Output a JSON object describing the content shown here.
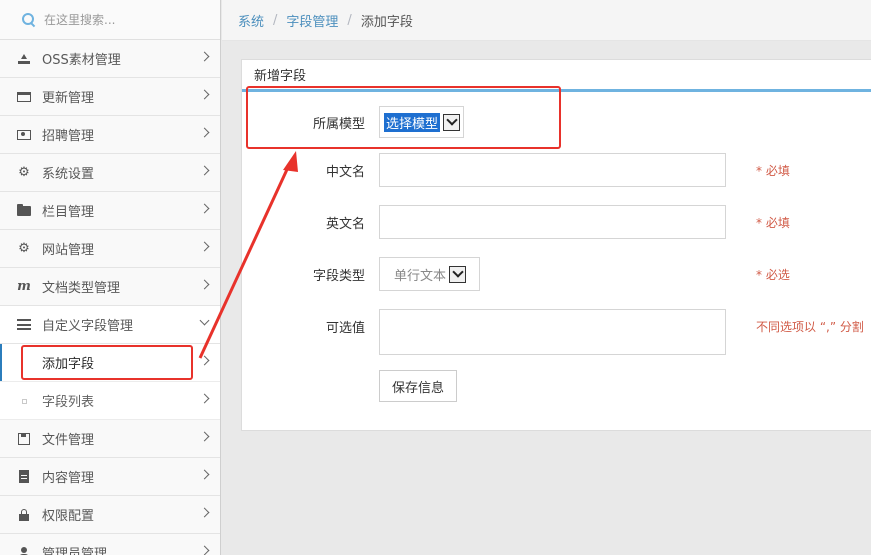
{
  "search": {
    "placeholder": "在这里搜索..."
  },
  "sidebar": {
    "items": [
      {
        "label": "OSS素材管理",
        "icon": "upload-icon"
      },
      {
        "label": "更新管理",
        "icon": "credit-card-icon"
      },
      {
        "label": "招聘管理",
        "icon": "money-icon"
      },
      {
        "label": "系统设置",
        "icon": "cog-icon"
      },
      {
        "label": "栏目管理",
        "icon": "folder-icon"
      },
      {
        "label": "网站管理",
        "icon": "cogs-icon"
      },
      {
        "label": "文档类型管理",
        "icon": "m-icon"
      },
      {
        "label": "自定义字段管理",
        "icon": "list-icon"
      },
      {
        "label": "添加字段",
        "icon": ""
      },
      {
        "label": "字段列表",
        "icon": ""
      },
      {
        "label": "文件管理",
        "icon": "save-icon"
      },
      {
        "label": "内容管理",
        "icon": "file-icon"
      },
      {
        "label": "权限配置",
        "icon": "lock-icon"
      },
      {
        "label": "管理员管理",
        "icon": "user-icon"
      }
    ]
  },
  "breadcrumb": {
    "root": "系统",
    "parent": "字段管理",
    "current": "添加字段",
    "sep": "/"
  },
  "panel": {
    "title": "新增字段",
    "model": {
      "label": "所属模型",
      "selected": "选择模型"
    },
    "cn_name": {
      "label": "中文名",
      "hint": "* 必填"
    },
    "en_name": {
      "label": "英文名",
      "hint": "* 必填"
    },
    "field_type": {
      "label": "字段类型",
      "selected": "单行文本",
      "hint": "* 必选"
    },
    "options": {
      "label": "可选值",
      "hint": "不同选项以 “,” 分割"
    },
    "save_label": "保存信息"
  },
  "colors": {
    "accent": "#6fb3e0",
    "link": "#4c8fbd",
    "hint": "#d15b47",
    "annotation": "#e8322b"
  }
}
